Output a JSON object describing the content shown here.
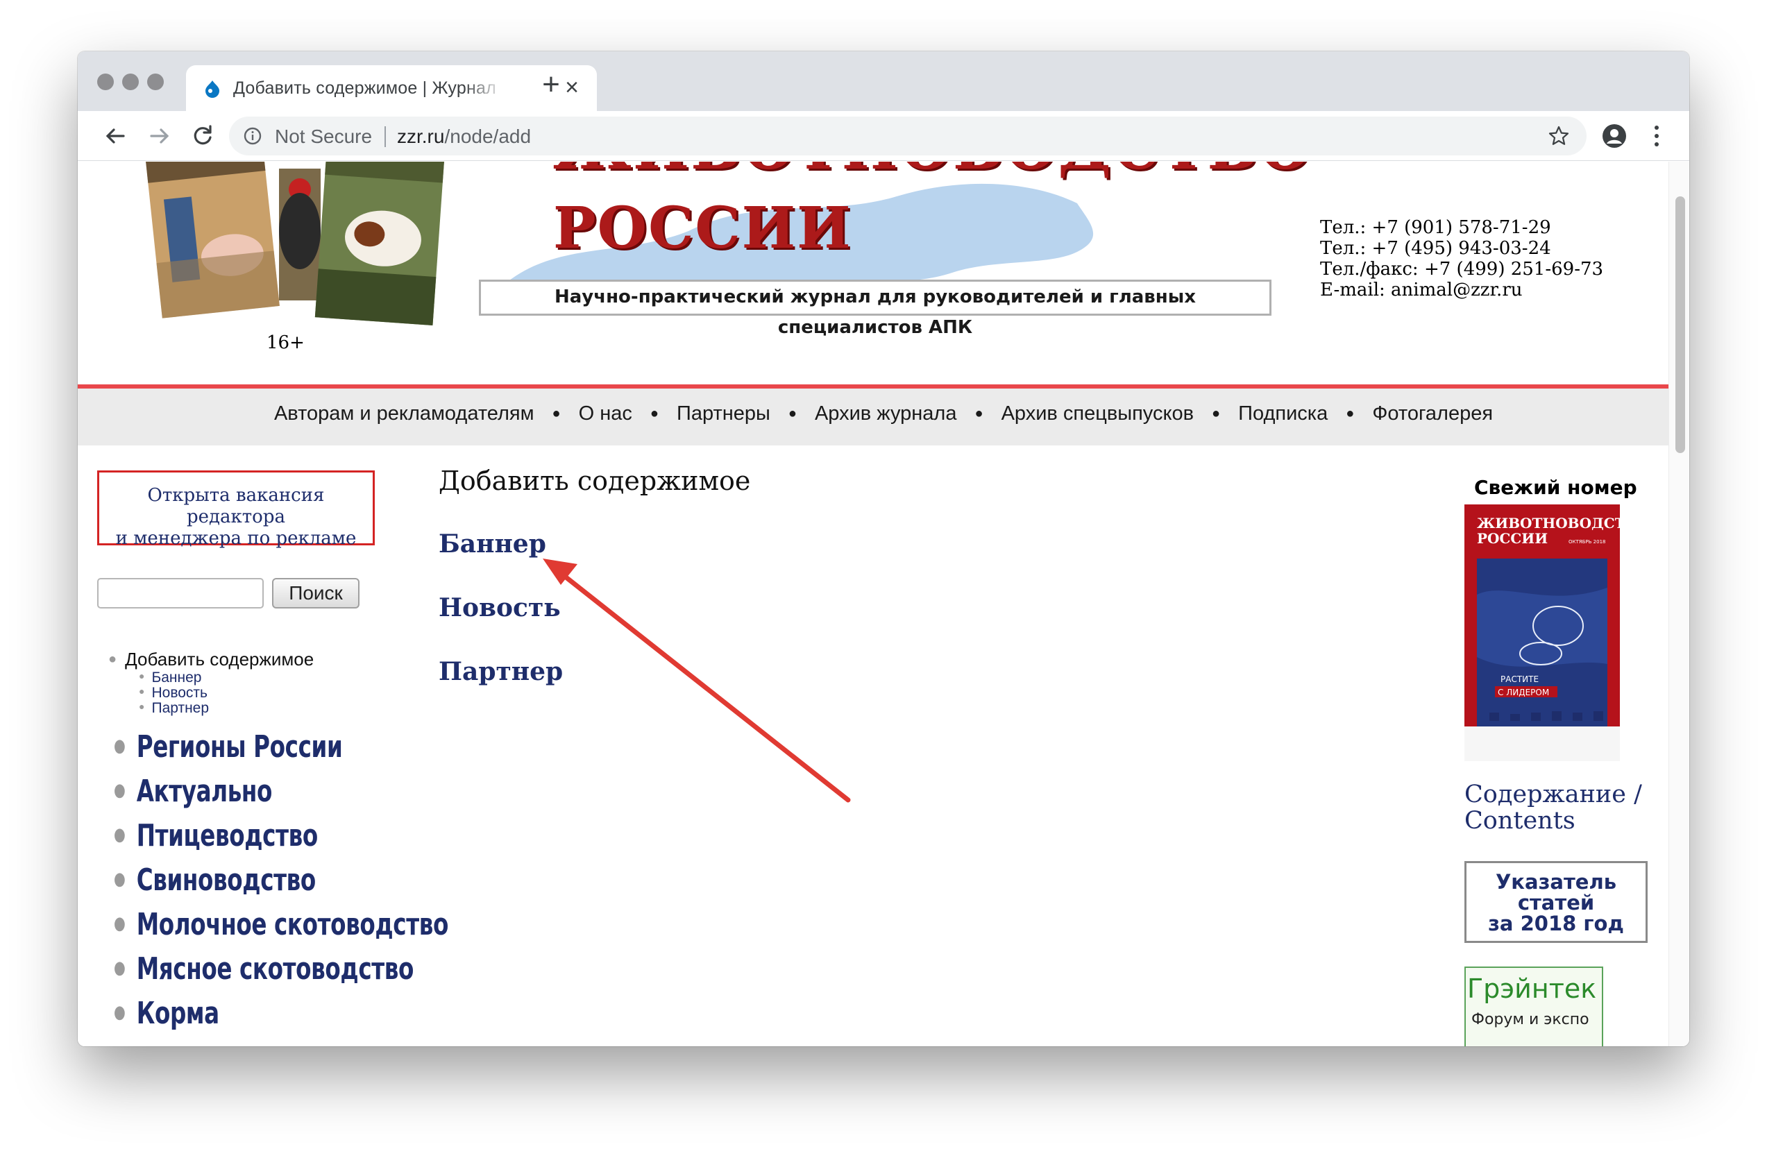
{
  "browser": {
    "tab_title": "Добавить содержимое | Журнал",
    "address_security": "Not Secure",
    "url_host": "zzr.ru",
    "url_path": "/node/add"
  },
  "header": {
    "age_rating": "16+",
    "logo_line1": "ЖИВОТНОВОДСТВО",
    "logo_line2": "РОССИИ",
    "subtitle": "Научно-практический журнал для руководителей и главных специалистов АПК",
    "contacts": [
      "Тел.: +7 (901) 578-71-29",
      "Тел.: +7 (495) 943-03-24",
      "Тел./факс: +7 (499) 251-69-73",
      "E-mail: animal@zzr.ru"
    ]
  },
  "nav": {
    "items": [
      "Авторам и рекламодателям",
      "О нас",
      "Партнеры",
      "Архив журнала",
      "Архив спецвыпусков",
      "Подписка",
      "Фотогалерея"
    ]
  },
  "sidebar_left": {
    "vacancy": [
      "Открыта вакансия редактора",
      "и менеджера по рекламе"
    ],
    "search_button": "Поиск",
    "search_value": "",
    "add_content": "Добавить содержимое",
    "add_subitems": [
      "Баннер",
      "Новость",
      "Партнер"
    ],
    "categories": [
      "Регионы России",
      "Актуально",
      "Птицеводство",
      "Свиноводство",
      "Молочное скотоводство",
      "Мясное скотоводство",
      "Корма"
    ]
  },
  "main": {
    "title": "Добавить содержимое",
    "links": [
      "Баннер",
      "Новость",
      "Партнер"
    ]
  },
  "sidebar_right": {
    "fresh_issue": "Свежий номер",
    "cover_title_line1": "ЖИВОТНОВОДСТВО",
    "cover_title_line2": "РОССИИ",
    "cover_month": "ОКТЯБРЬ 2018",
    "cover_slogan1": "РАСТИТЕ",
    "cover_slogan2": "С ЛИДЕРОМ",
    "contents_link": [
      "Содержание /",
      "Contents"
    ],
    "index_box": [
      "Указатель",
      "статей",
      "за 2018 год"
    ],
    "grain_title": "Грэйнтек",
    "grain_sub": "Форум и экспо"
  },
  "colors": {
    "link": "#1e2d6b",
    "accent_red": "#e9474b",
    "logo_red": "#ac1a1a",
    "nav_bg": "#ebebeb"
  }
}
